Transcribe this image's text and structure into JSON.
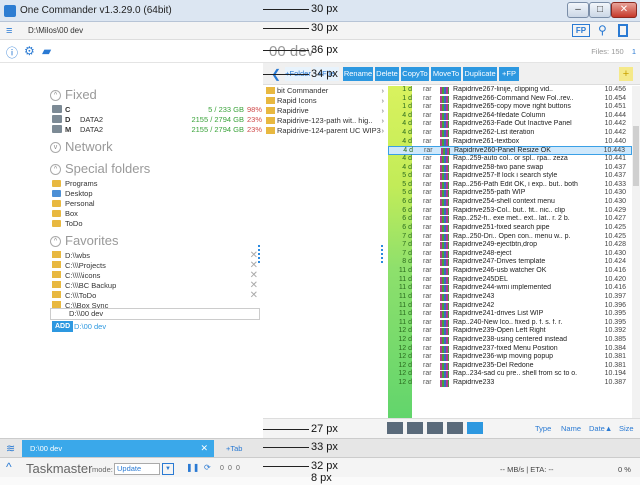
{
  "window": {
    "title": "One Commander v1.3.29.0 (64bit)",
    "min": "–",
    "max": "□",
    "close": "✕"
  },
  "pathbar": {
    "path": "D:\\Milos\\00 dev",
    "fp_label": "FP"
  },
  "guides": {
    "g1": "30 px",
    "g2": "30 px",
    "g3": "36 px",
    "g4": "34 px",
    "g5": "27 px",
    "g6": "33 px",
    "g7": "32 px",
    "g8": "8 px"
  },
  "left": {
    "sections": {
      "fixed": "Fixed",
      "network": "Network",
      "special": "Special folders",
      "favorites": "Favorites"
    },
    "drives": [
      {
        "letter": "C",
        "volume": "",
        "size": "5 / 233 GB",
        "pct": "98%"
      },
      {
        "letter": "D",
        "volume": "DATA2",
        "size": "2155 / 2794 GB",
        "pct": "23%"
      },
      {
        "letter": "M",
        "volume": "DATA2",
        "size": "2155 / 2794 GB",
        "pct": "23%"
      }
    ],
    "special_folders": [
      "Programs",
      "Desktop",
      "Personal",
      "Box",
      "ToDo"
    ],
    "favorites": [
      "D:\\\\wbs",
      "C:\\\\\\Projects",
      "C:\\\\\\\\\\icons",
      "C:\\\\\\BC Backup",
      "C:\\\\\\ToDo",
      "C:\\\\Box Sync"
    ],
    "favorite_edit": "D:\\\\00 dev",
    "add_label": "ADD",
    "add_path": "D:\\00 dev"
  },
  "right": {
    "title": "00 dev",
    "files_label": "Files: 150",
    "files_count": "1",
    "toolbar": {
      "folder": "+Folder",
      "file": "+File",
      "rename": "Rename",
      "delete": "Delete",
      "copyto": "CopyTo",
      "moveto": "MoveTo",
      "duplicate": "Duplicate",
      "fp": "+FP",
      "plus": "+"
    },
    "folders": [
      {
        "name": "bit Commander"
      },
      {
        "name": "Rapid Icons"
      },
      {
        "name": "Rapidrive"
      },
      {
        "name": "Rapidrive-123-path wit.. hig.."
      },
      {
        "name": "Rapidrive-124-parent UC WIP3"
      }
    ],
    "rows": [
      {
        "age": "1 d",
        "ext": "rar",
        "name": "Rapidrive267-linije, clipping vid..",
        "num": "10.456"
      },
      {
        "age": "1 d",
        "ext": "rar",
        "name": "Rapidrive266-Command New Fol..rev..",
        "num": "10.454"
      },
      {
        "age": "1 d",
        "ext": "rar",
        "name": "Rapidrive265-copy move right buttons",
        "num": "10.451"
      },
      {
        "age": "4 d",
        "ext": "rar",
        "name": "Rapidrive264-filedate Column",
        "num": "10.444"
      },
      {
        "age": "4 d",
        "ext": "rar",
        "name": "Rapidrive263-Fade Out Inactive Panel",
        "num": "10.442"
      },
      {
        "age": "4 d",
        "ext": "rar",
        "name": "Rapidrive262-List iteration",
        "num": "10.442"
      },
      {
        "age": "4 d",
        "ext": "rar",
        "name": "Rapidrive261-textbox",
        "num": "10.440"
      },
      {
        "age": "4 d",
        "ext": "rar",
        "name": "Rapidrive260-Panel Resize OK",
        "num": "10.443"
      },
      {
        "age": "4 d",
        "ext": "rar",
        "name": "Rap..259-auto col.. or spl.. rpa.. zeza",
        "num": "10.441"
      },
      {
        "age": "4 d",
        "ext": "rar",
        "name": "Rapidrive258-two pane swap",
        "num": "10.437"
      },
      {
        "age": "5 d",
        "ext": "rar",
        "name": "Rapidrive257-lf lock i search style",
        "num": "10.437"
      },
      {
        "age": "5 d",
        "ext": "rar",
        "name": "Rap..256-Path Edit OK, i exp.. but.. both",
        "num": "10.433"
      },
      {
        "age": "5 d",
        "ext": "rar",
        "name": "Rapidrive255-path WIP",
        "num": "10.430"
      },
      {
        "age": "6 d",
        "ext": "rar",
        "name": "Rapidrive254-shell context menu",
        "num": "10.430"
      },
      {
        "age": "6 d",
        "ext": "rar",
        "name": "Rapidrive253-Col.. but.. fit.. nic.. clip",
        "num": "10.429"
      },
      {
        "age": "6 d",
        "ext": "rar",
        "name": "Rap..252-fi.. exe met.. ext.. lat.. r. 2 b.",
        "num": "10.427"
      },
      {
        "age": "6 d",
        "ext": "rar",
        "name": "Rapidrive251-fixed search pipe",
        "num": "10.425"
      },
      {
        "age": "7 d",
        "ext": "rar",
        "name": "Rap..250-Dri.. Open con.. menu w.. p.",
        "num": "10.425"
      },
      {
        "age": "7 d",
        "ext": "rar",
        "name": "Rapidrive249-ejectbtn,drop",
        "num": "10.428"
      },
      {
        "age": "7 d",
        "ext": "rar",
        "name": "Rapidrive248-eject",
        "num": "10.430"
      },
      {
        "age": "8 d",
        "ext": "rar",
        "name": "Rapidrive247-Drives template",
        "num": "10.424"
      },
      {
        "age": "11 d",
        "ext": "rar",
        "name": "Rapidrive246-usb watcher OK",
        "num": "10.416"
      },
      {
        "age": "11 d",
        "ext": "rar",
        "name": "Rapidrive245DEL",
        "num": "10.420"
      },
      {
        "age": "11 d",
        "ext": "rar",
        "name": "Rapidrive244-wmi implemented",
        "num": "10.416"
      },
      {
        "age": "11 d",
        "ext": "rar",
        "name": "Rapidrive243",
        "num": "10.397"
      },
      {
        "age": "11 d",
        "ext": "rar",
        "name": "Rapidrive242",
        "num": "10.396"
      },
      {
        "age": "11 d",
        "ext": "rar",
        "name": "Rapidrive241-drives List WIP",
        "num": "10.395"
      },
      {
        "age": "11 d",
        "ext": "rar",
        "name": "Rap..240-New Ico.. fixed p. f. s. f. r.",
        "num": "10.395"
      },
      {
        "age": "12 d",
        "ext": "rar",
        "name": "Rapidrive239-Open Left Right",
        "num": "10.392"
      },
      {
        "age": "12 d",
        "ext": "rar",
        "name": "Rapidrive238-using centered instead",
        "num": "10.385"
      },
      {
        "age": "12 d",
        "ext": "rar",
        "name": "Rapidrive237-fixed Menu Position",
        "num": "10.384"
      },
      {
        "age": "12 d",
        "ext": "rar",
        "name": "Rapidrive236-wip moving popup",
        "num": "10.381"
      },
      {
        "age": "12 d",
        "ext": "rar",
        "name": "Rapidrive235-Del Redone",
        "num": "10.381"
      },
      {
        "age": "12 d",
        "ext": "rar",
        "name": "Rap..234-sad cu pre.. shell from sc to o.",
        "num": "10.194"
      },
      {
        "age": "12 d",
        "ext": "rar",
        "name": "Rapidrive233",
        "num": "10.387"
      }
    ],
    "footer": {
      "type": "Type",
      "name": "Name",
      "date": "Date▲",
      "size": "Size"
    }
  },
  "tabs": {
    "active": "D:\\00 dev",
    "add": "+Tab"
  },
  "taskmaster": {
    "title": "Taskmaster",
    "mode_label": "mode:",
    "mode_value": "Update",
    "count_a": "0",
    "count_b": "0",
    "count_c": "0",
    "rate": "-- MB/s | ETA:   --",
    "pct": "0 %"
  },
  "colors": {
    "accent": "#2d98e0",
    "selection": "#cfe8fb"
  }
}
